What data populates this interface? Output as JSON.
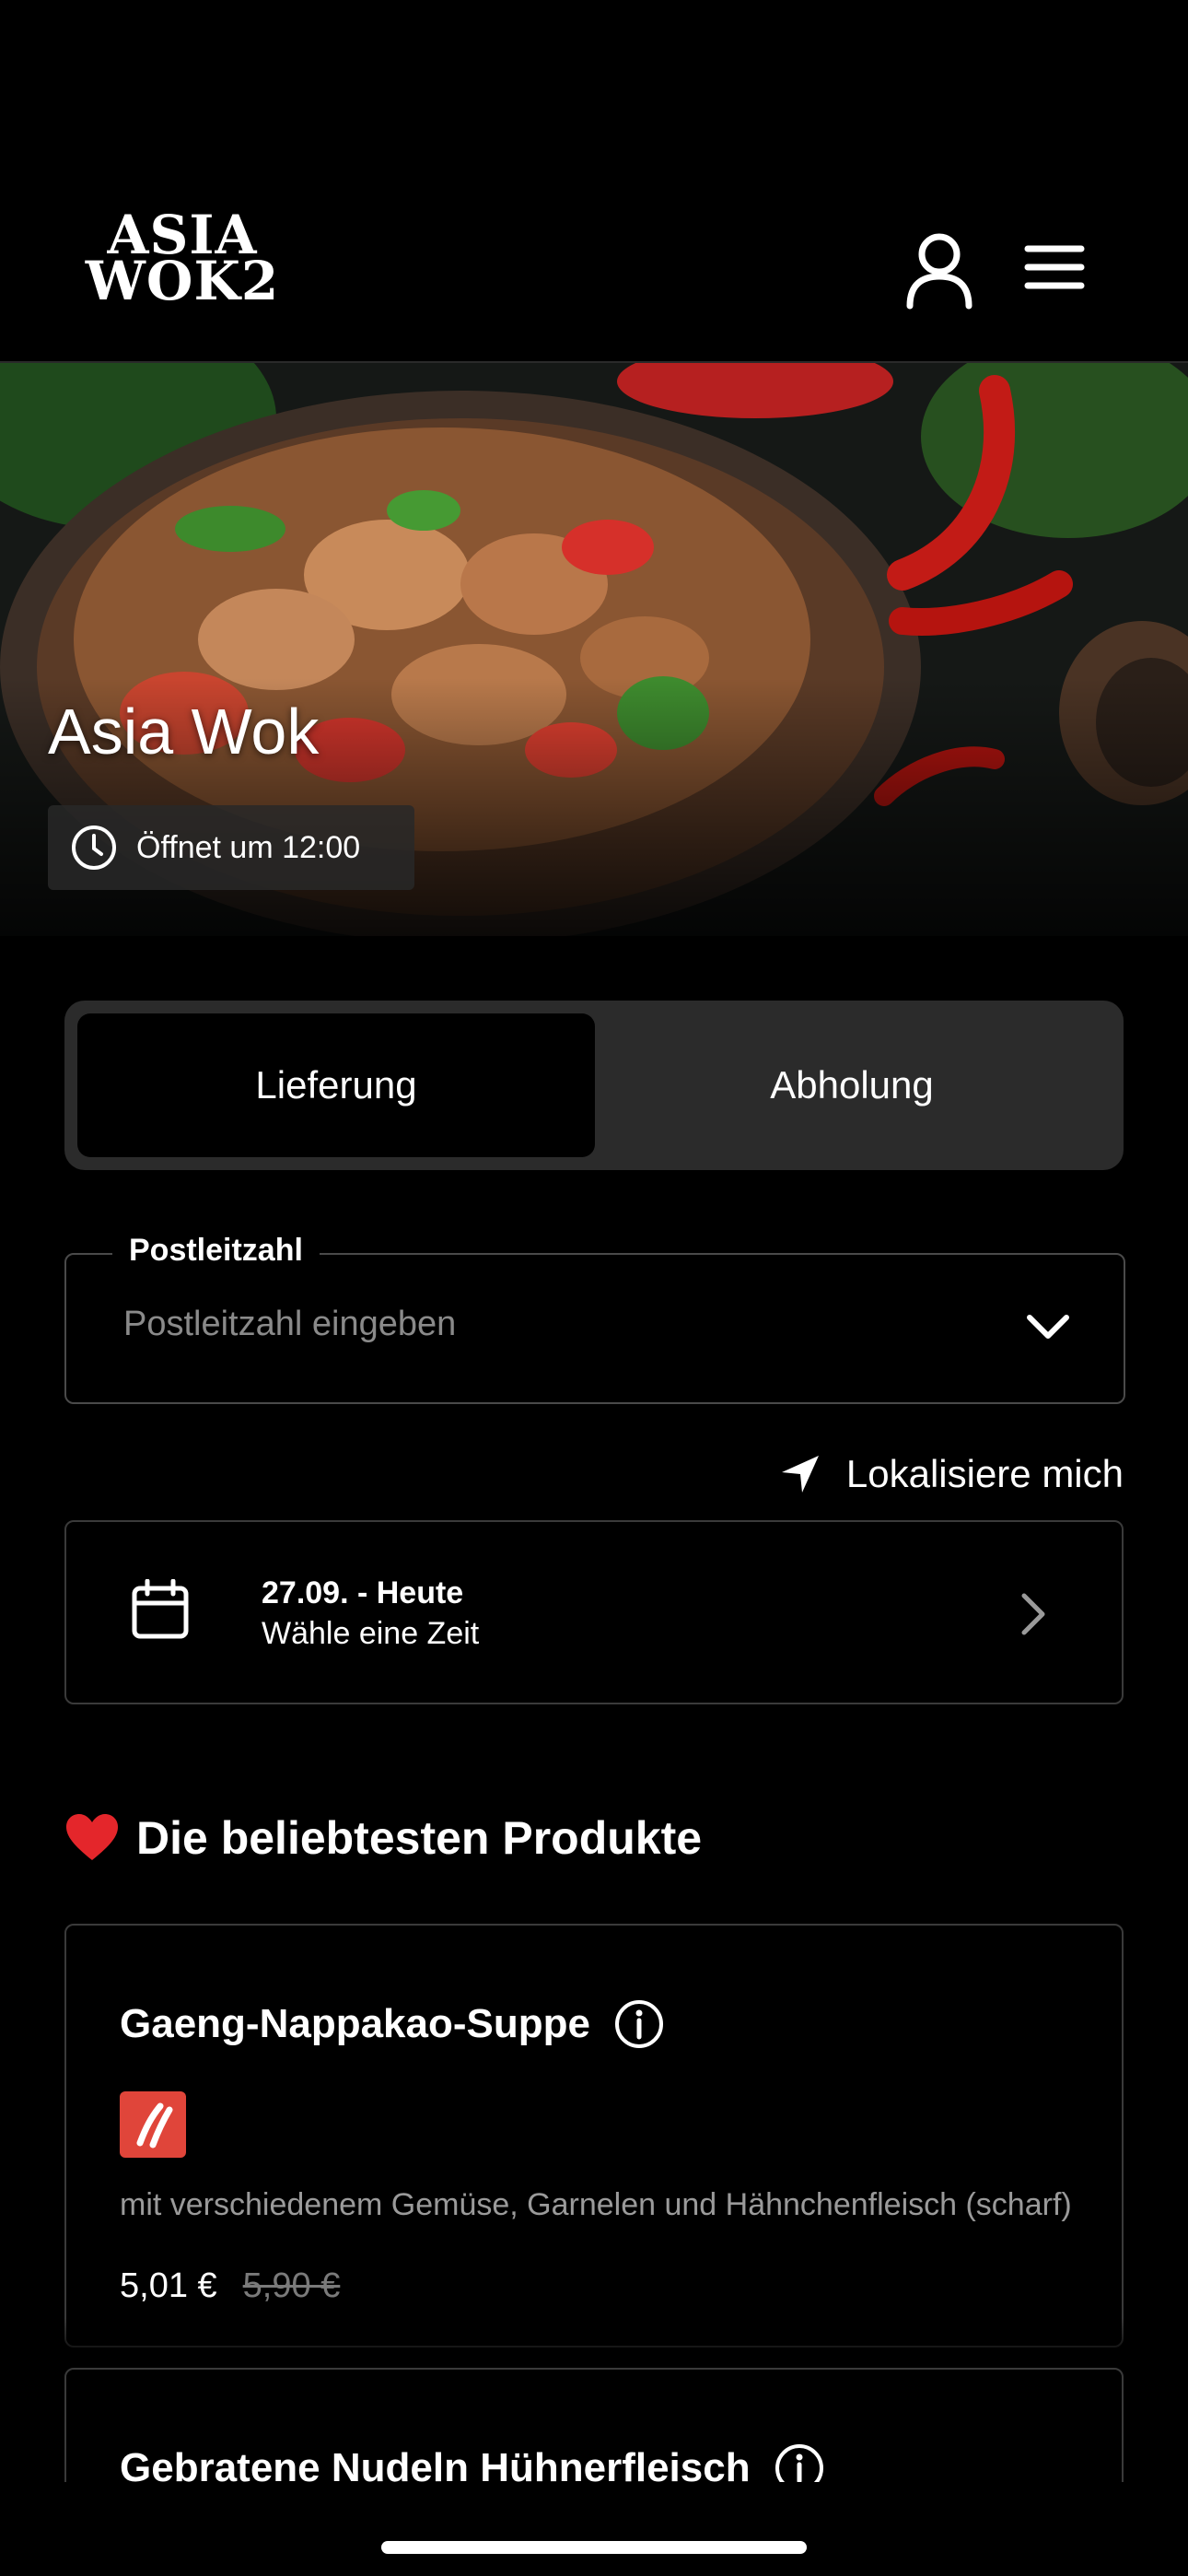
{
  "header": {
    "logo_line1": "ASIA",
    "logo_line2": "WOK2"
  },
  "hero": {
    "restaurant_name": "Asia Wok",
    "opening_status": "Öffnet um 12:00"
  },
  "order_mode": {
    "options": [
      "Lieferung",
      "Abholung"
    ],
    "selected": "Lieferung"
  },
  "postcode": {
    "label": "Postleitzahl",
    "placeholder": "Postleitzahl eingeben",
    "value": ""
  },
  "locate": {
    "label": "Lokalisiere mich"
  },
  "date_picker": {
    "date_label": "27.09. - Heute",
    "time_label": "Wähle eine Zeit"
  },
  "popular": {
    "title": "Die beliebtesten Produkte",
    "products": [
      {
        "name": "Gaeng-Nappakao-Suppe",
        "description": "mit verschiedenem Gemüse, Garnelen und Hähnchenfleisch (scharf)",
        "price": "5,01 €",
        "old_price": "5,90 €",
        "spicy": true
      },
      {
        "name": "Gebratene Nudeln Hühnerfleisch"
      }
    ]
  },
  "colors": {
    "background": "#000000",
    "toggle_bg": "#2b2b2b",
    "spicy_badge": "#e0453a",
    "muted_text": "#9a9a9a"
  }
}
